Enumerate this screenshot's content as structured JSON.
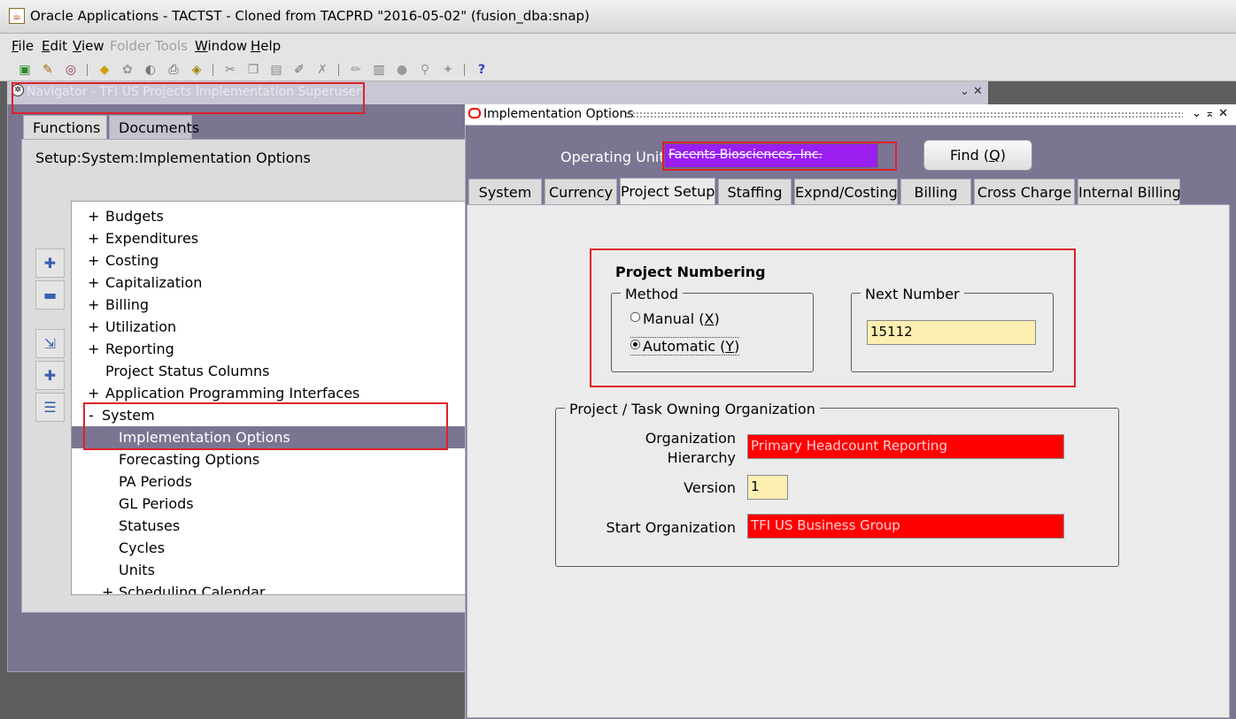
{
  "app": {
    "title": "Oracle Applications - TACTST - Cloned from TACPRD \"2016-05-02\" (fusion_dba:snap)",
    "title_icon": "java-icon"
  },
  "menu": [
    {
      "label": "File",
      "ul": "F",
      "rest": "ile",
      "disabled": false
    },
    {
      "label": "Edit",
      "ul": "E",
      "rest": "dit",
      "disabled": false
    },
    {
      "label": "View",
      "ul": "V",
      "rest": "iew",
      "disabled": false
    },
    {
      "label": "Folder",
      "ul": "",
      "rest": "Folder",
      "disabled": true
    },
    {
      "label": "Tools",
      "ul": "",
      "rest": "Tools",
      "disabled": true
    },
    {
      "label": "Window",
      "ul": "W",
      "rest": "indow",
      "disabled": false
    },
    {
      "label": "Help",
      "ul": "H",
      "rest": "elp",
      "disabled": false
    }
  ],
  "navigator": {
    "title": "Navigator - TFI US Projects Implementation Superuser",
    "tabs": [
      "Functions",
      "Documents"
    ],
    "path": "Setup:System:Implementation Options",
    "tree": [
      {
        "exp": "+",
        "label": "Budgets",
        "level": 0
      },
      {
        "exp": "+",
        "label": "Expenditures",
        "level": 0
      },
      {
        "exp": "+",
        "label": "Costing",
        "level": 0
      },
      {
        "exp": "+",
        "label": "Capitalization",
        "level": 0
      },
      {
        "exp": "+",
        "label": "Billing",
        "level": 0
      },
      {
        "exp": "+",
        "label": "Utilization",
        "level": 0
      },
      {
        "exp": "+",
        "label": "Reporting",
        "level": 0
      },
      {
        "exp": "",
        "label": "Project Status Columns",
        "level": 0
      },
      {
        "exp": "+",
        "label": "Application Programming Interfaces",
        "level": 0
      },
      {
        "exp": "-",
        "label": "System",
        "level": 0
      },
      {
        "exp": "",
        "label": "Implementation Options",
        "level": 1,
        "selected": true
      },
      {
        "exp": "",
        "label": "Forecasting Options",
        "level": 1
      },
      {
        "exp": "",
        "label": "PA Periods",
        "level": 1
      },
      {
        "exp": "",
        "label": "GL Periods",
        "level": 1
      },
      {
        "exp": "",
        "label": "Statuses",
        "level": 1
      },
      {
        "exp": "",
        "label": "Cycles",
        "level": 1
      },
      {
        "exp": "",
        "label": "Units",
        "level": 1
      },
      {
        "exp": "+",
        "label": "Scheduling Calendar",
        "level": 1
      }
    ]
  },
  "impl": {
    "title": "Implementation Options",
    "operating_unit_label": "Operating Unit",
    "operating_unit_value": "Facents Biosciences, Inc.",
    "find_label": "Find",
    "find_key": "Q",
    "tabs": [
      "System",
      "Currency",
      "Project Setup",
      "Staffing",
      "Expnd/Costing",
      "Billing",
      "Cross Charge",
      "Internal Billing"
    ],
    "active_tab": "Project Setup",
    "project_numbering": {
      "heading": "Project Numbering",
      "method_legend": "Method",
      "manual_label": "Manual",
      "manual_key": "X",
      "automatic_label": "Automatic",
      "automatic_key": "Y",
      "selected": "Automatic",
      "next_number_legend": "Next Number",
      "next_number": "15112"
    },
    "owning_org": {
      "legend": "Project / Task Owning Organization",
      "org_hierarchy_label_1": "Organization",
      "org_hierarchy_label_2": "Hierarchy",
      "org_hierarchy_value": "Primary Headcount Reporting",
      "version_label": "Version",
      "version_value": "1",
      "start_org_label": "Start Organization",
      "start_org_value": "TFI US Business Group"
    }
  },
  "colors": {
    "window_bg": "#7b7592",
    "required_field": "#ff0000",
    "editable_field": "#fdefb2",
    "operating_unit_field": "#9b1ef0",
    "annotation_box": "#e0202a"
  }
}
